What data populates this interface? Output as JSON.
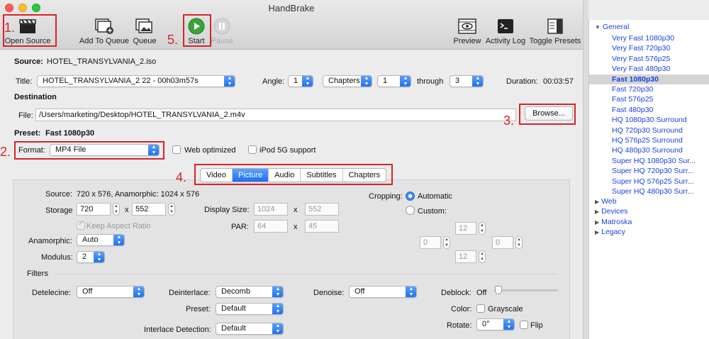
{
  "window": {
    "title": "HandBrake"
  },
  "toolbar": {
    "open_source": "Open Source",
    "add_to_queue": "Add To Queue",
    "queue": "Queue",
    "start": "Start",
    "pause": "Pause",
    "preview": "Preview",
    "activity_log": "Activity Log",
    "toggle_presets": "Toggle Presets"
  },
  "annotations": {
    "n1": "1.",
    "n2": "2.",
    "n3": "3.",
    "n4": "4.",
    "n5": "5."
  },
  "source": {
    "label": "Source:",
    "value": "HOTEL_TRANSYLVANIA_2.iso"
  },
  "title_row": {
    "label": "Title:",
    "value": "HOTEL_TRANSYLVANIA_2 22 - 00h03m57s",
    "angle_label": "Angle:",
    "angle": "1",
    "range_type": "Chapters",
    "from": "1",
    "through_label": "through",
    "to": "3",
    "duration_label": "Duration:",
    "duration": "00:03:57"
  },
  "destination": {
    "heading": "Destination",
    "file_label": "File:",
    "file_value": "/Users/marketing/Desktop/HOTEL_TRANSYLVANIA_2.m4v",
    "browse": "Browse..."
  },
  "preset": {
    "label": "Preset:",
    "value": "Fast 1080p30"
  },
  "format": {
    "label": "Format:",
    "value": "MP4 File",
    "web_optimized": "Web optimized",
    "ipod": "iPod 5G support"
  },
  "tabs": [
    "Video",
    "Picture",
    "Audio",
    "Subtitles",
    "Chapters"
  ],
  "picture": {
    "source_label": "Source:",
    "source_value": "720 x 576, Anamorphic: 1024 x 576",
    "storage_label": "Storage",
    "storage_w": "720",
    "x1": "x",
    "storage_h": "552",
    "display_label": "Display Size:",
    "display_w": "1024",
    "x2": "x",
    "display_h": "552",
    "keep_aspect": "Keep Aspect Ratio",
    "par_label": "PAR:",
    "par_w": "64",
    "x3": "x",
    "par_h": "45",
    "anamorphic_label": "Anamorphic:",
    "anamorphic_value": "Auto",
    "modulus_label": "Modulus:",
    "modulus_value": "2",
    "cropping_label": "Cropping:",
    "automatic": "Automatic",
    "custom": "Custom:",
    "crop_top": "12",
    "crop_left": "0",
    "crop_right": "0",
    "crop_bottom": "12"
  },
  "filters": {
    "heading": "Filters",
    "detelecine_label": "Detelecine:",
    "detelecine": "Off",
    "deinterlace_label": "Deinterlace:",
    "deinterlace": "Decomb",
    "denoise_label": "Denoise:",
    "denoise": "Off",
    "deblock_label": "Deblock:",
    "deblock": "Off",
    "preset_label": "Preset:",
    "preset": "Default",
    "color_label": "Color:",
    "grayscale": "Grayscale",
    "interlace_label": "Interlace Detection:",
    "interlace": "Default",
    "rotate_label": "Rotate:",
    "rotate": "0°",
    "flip": "Flip"
  },
  "presets": {
    "general": "General",
    "items": [
      "Very Fast 1080p30",
      "Very Fast 720p30",
      "Very Fast 576p25",
      "Very Fast 480p30",
      "Fast 1080p30",
      "Fast 720p30",
      "Fast 576p25",
      "Fast 480p30",
      "HQ 1080p30 Surround",
      "HQ 720p30 Surround",
      "HQ 576p25 Surround",
      "HQ 480p30 Surround",
      "Super HQ 1080p30 Sur...",
      "Super HQ 720p30 Surr...",
      "Super HQ 576p25 Surr...",
      "Super HQ 480p30 Surr..."
    ],
    "groups": [
      "Web",
      "Devices",
      "Matroska",
      "Legacy"
    ]
  },
  "colors": {
    "accent": "#1b6ef2",
    "annotation_red": "#d8232a",
    "preset_link": "#1a3fe0"
  }
}
